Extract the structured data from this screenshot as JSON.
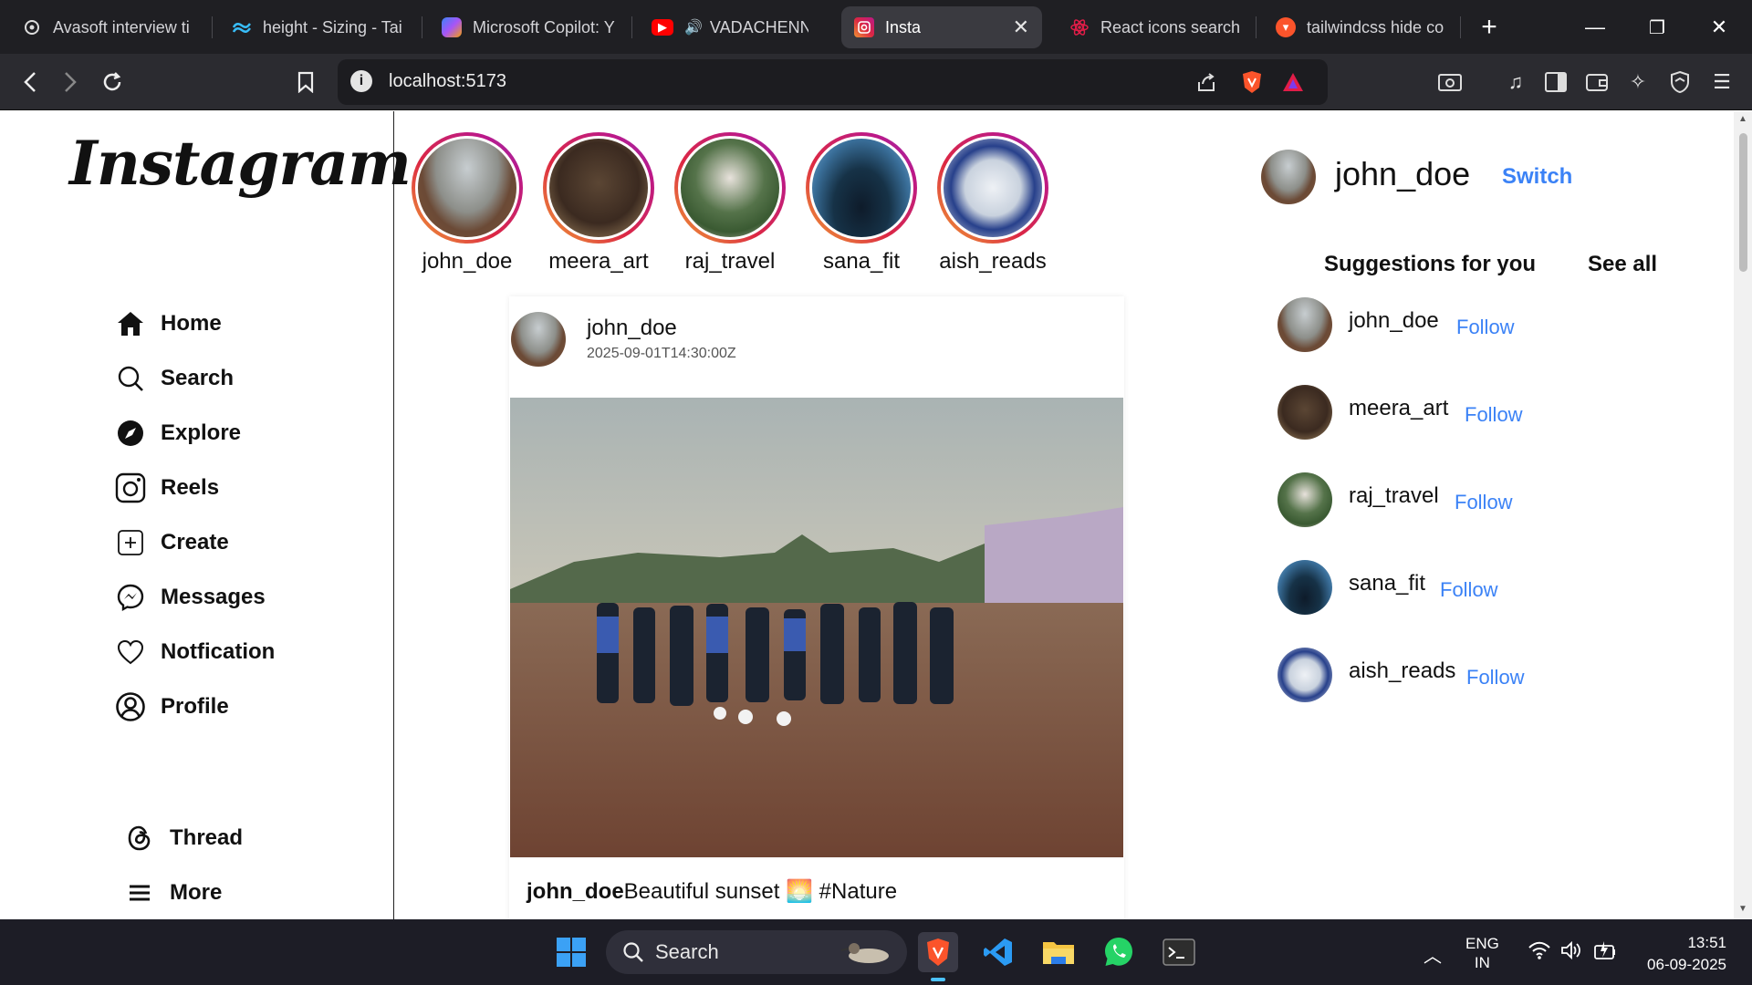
{
  "browser": {
    "tabs": [
      {
        "title": "Avasoft interview ti",
        "icon": "chatgpt-icon"
      },
      {
        "title": "height - Sizing - Tai",
        "icon": "tailwind-icon"
      },
      {
        "title": "Microsoft Copilot: Y",
        "icon": "copilot-icon"
      },
      {
        "title": "VADACHENNAI",
        "icon": "youtube-icon"
      },
      {
        "title": "Insta",
        "icon": "instagram-icon",
        "active": true
      },
      {
        "title": "React icons search",
        "icon": "react-icon"
      },
      {
        "title": "tailwindcss hide co",
        "icon": "brave-icon"
      }
    ],
    "url": "localhost:5173"
  },
  "sidebar": {
    "logo": "Instagram",
    "nav": [
      {
        "label": "Home",
        "icon": "home-icon"
      },
      {
        "label": "Search",
        "icon": "search-icon"
      },
      {
        "label": "Explore",
        "icon": "compass-icon"
      },
      {
        "label": "Reels",
        "icon": "reels-icon"
      },
      {
        "label": "Create",
        "icon": "plus-square-icon"
      },
      {
        "label": "Messages",
        "icon": "messenger-icon"
      },
      {
        "label": "Notfication",
        "icon": "heart-icon"
      },
      {
        "label": "Profile",
        "icon": "user-circle-icon"
      }
    ],
    "bottom": [
      {
        "label": "Thread",
        "icon": "threads-icon"
      },
      {
        "label": "More",
        "icon": "menu-icon"
      }
    ]
  },
  "stories": [
    {
      "name": "john_doe"
    },
    {
      "name": "meera_art"
    },
    {
      "name": "raj_travel"
    },
    {
      "name": "sana_fit"
    },
    {
      "name": "aish_reads"
    }
  ],
  "post": {
    "username": "john_doe",
    "timestamp": "2025-09-01T14:30:00Z",
    "caption_user": "john_doe",
    "caption_text": "Beautiful sunset 🌅 #Nature"
  },
  "me": {
    "username": "john_doe",
    "switch_label": "Switch"
  },
  "suggestions": {
    "title": "Suggestions for you",
    "see_all": "See all",
    "follow_label": "Follow",
    "users": [
      {
        "name": "john_doe"
      },
      {
        "name": "meera_art"
      },
      {
        "name": "raj_travel"
      },
      {
        "name": "sana_fit"
      },
      {
        "name": "aish_reads"
      }
    ]
  },
  "taskbar": {
    "search_placeholder": "Search",
    "lang_line1": "ENG",
    "lang_line2": "IN",
    "time": "13:51",
    "date": "06-09-2025"
  },
  "colors": {
    "accent": "#3b82f6",
    "story_ring": "#dc2743"
  }
}
